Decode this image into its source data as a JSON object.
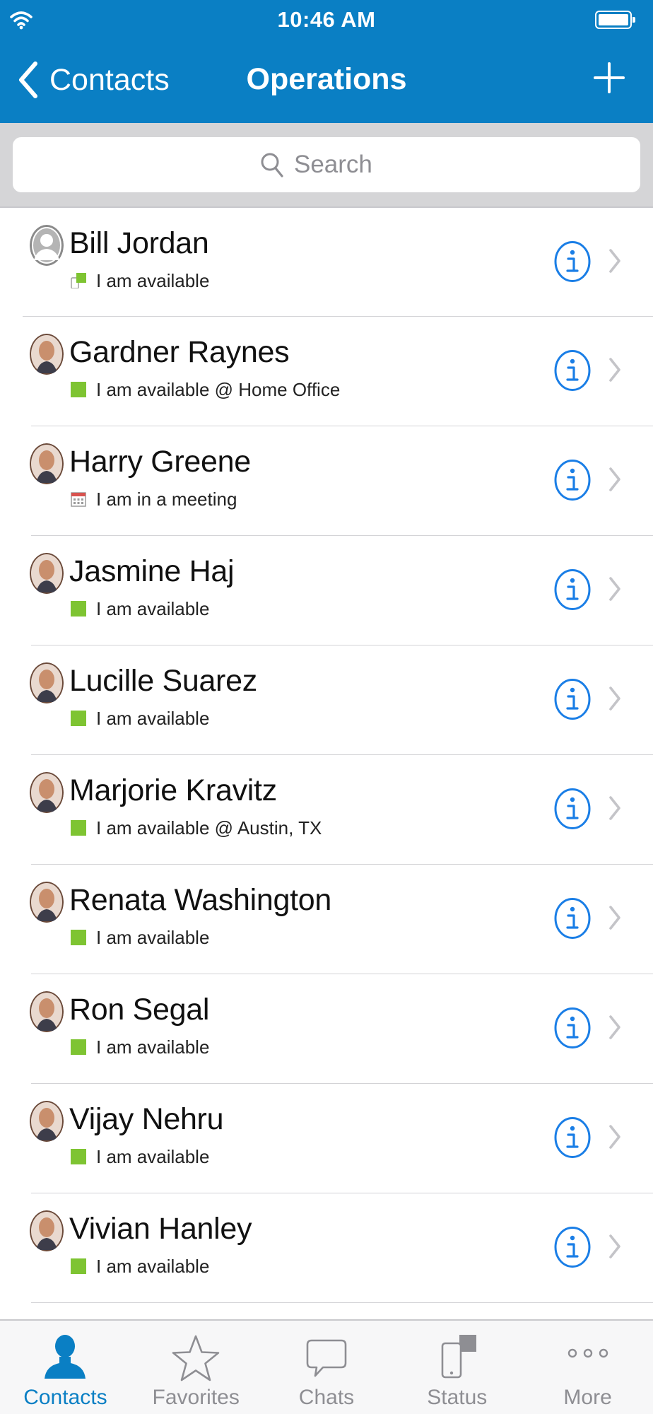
{
  "status_bar": {
    "time": "10:46 AM"
  },
  "nav": {
    "back_label": "Contacts",
    "title": "Operations"
  },
  "search": {
    "placeholder": "Search"
  },
  "colors": {
    "brand": "#0a7fc4",
    "available": "#7ec432",
    "info_blue": "#1a7ee6"
  },
  "contacts": [
    {
      "name": "Bill Jordan",
      "status": "I am available",
      "presence_icon": "mobile-available-icon",
      "avatar": "placeholder-avatar"
    },
    {
      "name": "Gardner Raynes",
      "status": "I am available @ Home Office",
      "presence_icon": "available-icon",
      "avatar": "photo-avatar"
    },
    {
      "name": "Harry Greene",
      "status": "I am in a meeting",
      "presence_icon": "calendar-icon",
      "avatar": "photo-avatar"
    },
    {
      "name": "Jasmine Haj",
      "status": "I am available",
      "presence_icon": "available-icon",
      "avatar": "photo-avatar"
    },
    {
      "name": "Lucille Suarez",
      "status": "I am available",
      "presence_icon": "available-icon",
      "avatar": "photo-avatar"
    },
    {
      "name": "Marjorie Kravitz",
      "status": "I am available @ Austin, TX",
      "presence_icon": "available-icon",
      "avatar": "photo-avatar"
    },
    {
      "name": "Renata Washington",
      "status": "I am available",
      "presence_icon": "available-icon",
      "avatar": "photo-avatar"
    },
    {
      "name": "Ron Segal",
      "status": "I am available",
      "presence_icon": "available-icon",
      "avatar": "photo-avatar"
    },
    {
      "name": "Vijay Nehru",
      "status": "I am available",
      "presence_icon": "available-icon",
      "avatar": "photo-avatar"
    },
    {
      "name": "Vivian Hanley",
      "status": "I am available",
      "presence_icon": "available-icon",
      "avatar": "photo-avatar"
    }
  ],
  "tabs": [
    {
      "label": "Contacts",
      "icon": "person-icon",
      "active": true
    },
    {
      "label": "Favorites",
      "icon": "star-icon",
      "active": false
    },
    {
      "label": "Chats",
      "icon": "chat-bubble-icon",
      "active": false
    },
    {
      "label": "Status",
      "icon": "status-device-icon",
      "active": false
    },
    {
      "label": "More",
      "icon": "ellipsis-icon",
      "active": false
    }
  ]
}
